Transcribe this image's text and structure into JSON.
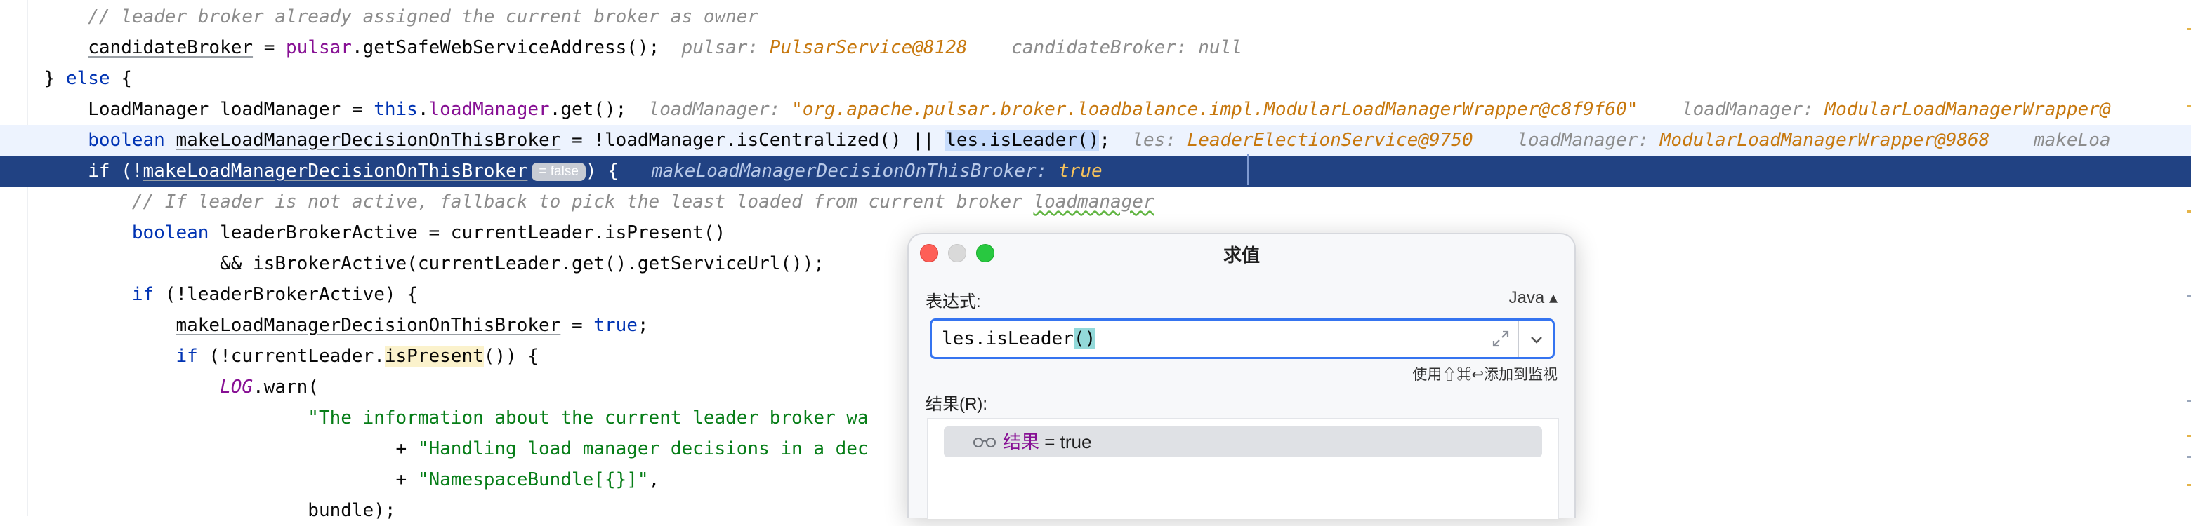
{
  "code_lines": [
    [
      {
        "t": "        "
      },
      {
        "t": "// leader broker already assigned the current broker as owner",
        "c": "cm"
      }
    ],
    [
      {
        "t": "        "
      },
      {
        "t": "candidateBroker",
        "c": "u"
      },
      {
        "t": " = "
      },
      {
        "t": "pulsar",
        "c": "fld"
      },
      {
        "t": ".getSafeWebServiceAddress();"
      },
      {
        "t": "  pulsar: ",
        "c": "dbg"
      },
      {
        "t": "PulsarService@8128",
        "c": "dv"
      },
      {
        "t": "    candidateBroker: null",
        "c": "dbg"
      }
    ],
    [
      {
        "t": "    } "
      },
      {
        "t": "else",
        "c": "kw"
      },
      {
        "t": " {"
      }
    ],
    [
      {
        "t": "        LoadManager loadManager = "
      },
      {
        "t": "this",
        "c": "kw"
      },
      {
        "t": "."
      },
      {
        "t": "loadManager",
        "c": "fld"
      },
      {
        "t": ".get();"
      },
      {
        "t": "  loadManager: ",
        "c": "dbg"
      },
      {
        "t": "\"org.apache.pulsar.broker.loadbalance.impl.ModularLoadManagerWrapper@c8f9f60\"",
        "c": "dv"
      },
      {
        "t": "    loadManager: ",
        "c": "dbg"
      },
      {
        "t": "ModularLoadManagerWrapper@",
        "c": "dv"
      }
    ],
    [
      {
        "t": "        "
      },
      {
        "t": "boolean",
        "c": "kw"
      },
      {
        "t": " "
      },
      {
        "t": "makeLoadManagerDecisionOnThisBroker",
        "c": "u"
      },
      {
        "t": " = !loadManager.isCentralized() || "
      },
      {
        "t": "les.isLeader()",
        "c": "hl-sel"
      },
      {
        "t": ";"
      },
      {
        "t": "  les: ",
        "c": "dbg"
      },
      {
        "t": "LeaderElectionService@9750",
        "c": "dv"
      },
      {
        "t": "    loadManager: ",
        "c": "dbg"
      },
      {
        "t": "ModularLoadManagerWrapper@9868",
        "c": "dv"
      },
      {
        "t": "    makeLoa",
        "c": "dbg"
      }
    ],
    [
      {
        "t": "        "
      },
      {
        "t": "if",
        "c": "kw"
      },
      {
        "t": " (!"
      },
      {
        "t": "makeLoadManagerDecisionOnThisBroker",
        "c": "u"
      },
      {
        "t": "= false",
        "c": "badge"
      },
      {
        "t": ") {  "
      },
      {
        "t": " makeLoadManagerDecisionOnThisBroker: ",
        "c": "dbg"
      },
      {
        "t": "true",
        "c": "dv"
      }
    ],
    [
      {
        "t": "            "
      },
      {
        "t": "// If leader is not active, fallback to pick the least loaded from current broker ",
        "c": "cm"
      },
      {
        "t": "loadmanager",
        "c": "cm sq"
      }
    ],
    [
      {
        "t": "            "
      },
      {
        "t": "boolean",
        "c": "kw"
      },
      {
        "t": " leaderBrokerActive = currentLeader.isPresent()"
      }
    ],
    [
      {
        "t": "                    && isBrokerActive(currentLeader.get().getServiceUrl());"
      }
    ],
    [
      {
        "t": "            "
      },
      {
        "t": "if",
        "c": "kw"
      },
      {
        "t": " (!leaderBrokerActive) {"
      }
    ],
    [
      {
        "t": "                "
      },
      {
        "t": "makeLoadManagerDecisionOnThisBroker",
        "c": "u"
      },
      {
        "t": " = "
      },
      {
        "t": "true",
        "c": "kw"
      },
      {
        "t": ";"
      }
    ],
    [
      {
        "t": "                "
      },
      {
        "t": "if",
        "c": "kw"
      },
      {
        "t": " (!currentLeader."
      },
      {
        "t": "isPresent",
        "c": "hl-yel"
      },
      {
        "t": "()) {"
      }
    ],
    [
      {
        "t": "                    "
      },
      {
        "t": "LOG",
        "c": "fld itl"
      },
      {
        "t": ".warn("
      }
    ],
    [
      {
        "t": "                            "
      },
      {
        "t": "\"The information about the current leader broker wa",
        "c": "st"
      }
    ],
    [
      {
        "t": "                                    + "
      },
      {
        "t": "\"Handling load manager decisions in a dec",
        "c": "st"
      }
    ],
    [
      {
        "t": "                                    + "
      },
      {
        "t": "\"NamespaceBundle[{}]\"",
        "c": "st"
      },
      {
        "t": ","
      }
    ],
    [
      {
        "t": "                            bundle);"
      }
    ]
  ],
  "dialog": {
    "title": "求值",
    "expression_label": "表达式:",
    "language": "Java ▴",
    "expression_value": "les.isLeader",
    "expression_parens": "()",
    "hint": "使用⇧⌘↩添加到监视",
    "result_label": "结果(R):",
    "result": {
      "name": "结果",
      "equals": " = ",
      "value": "true",
      "icon": "glasses-icon"
    }
  },
  "colors": {
    "keyword": "#0033b3",
    "field": "#871094",
    "string": "#067d17",
    "comment": "#8c8c8c",
    "debug_value": "#c7780e",
    "execution_line": "#214283",
    "caret_line": "#edf3fe",
    "selection": "#c7dcfc",
    "input_focus": "#3574f0"
  }
}
